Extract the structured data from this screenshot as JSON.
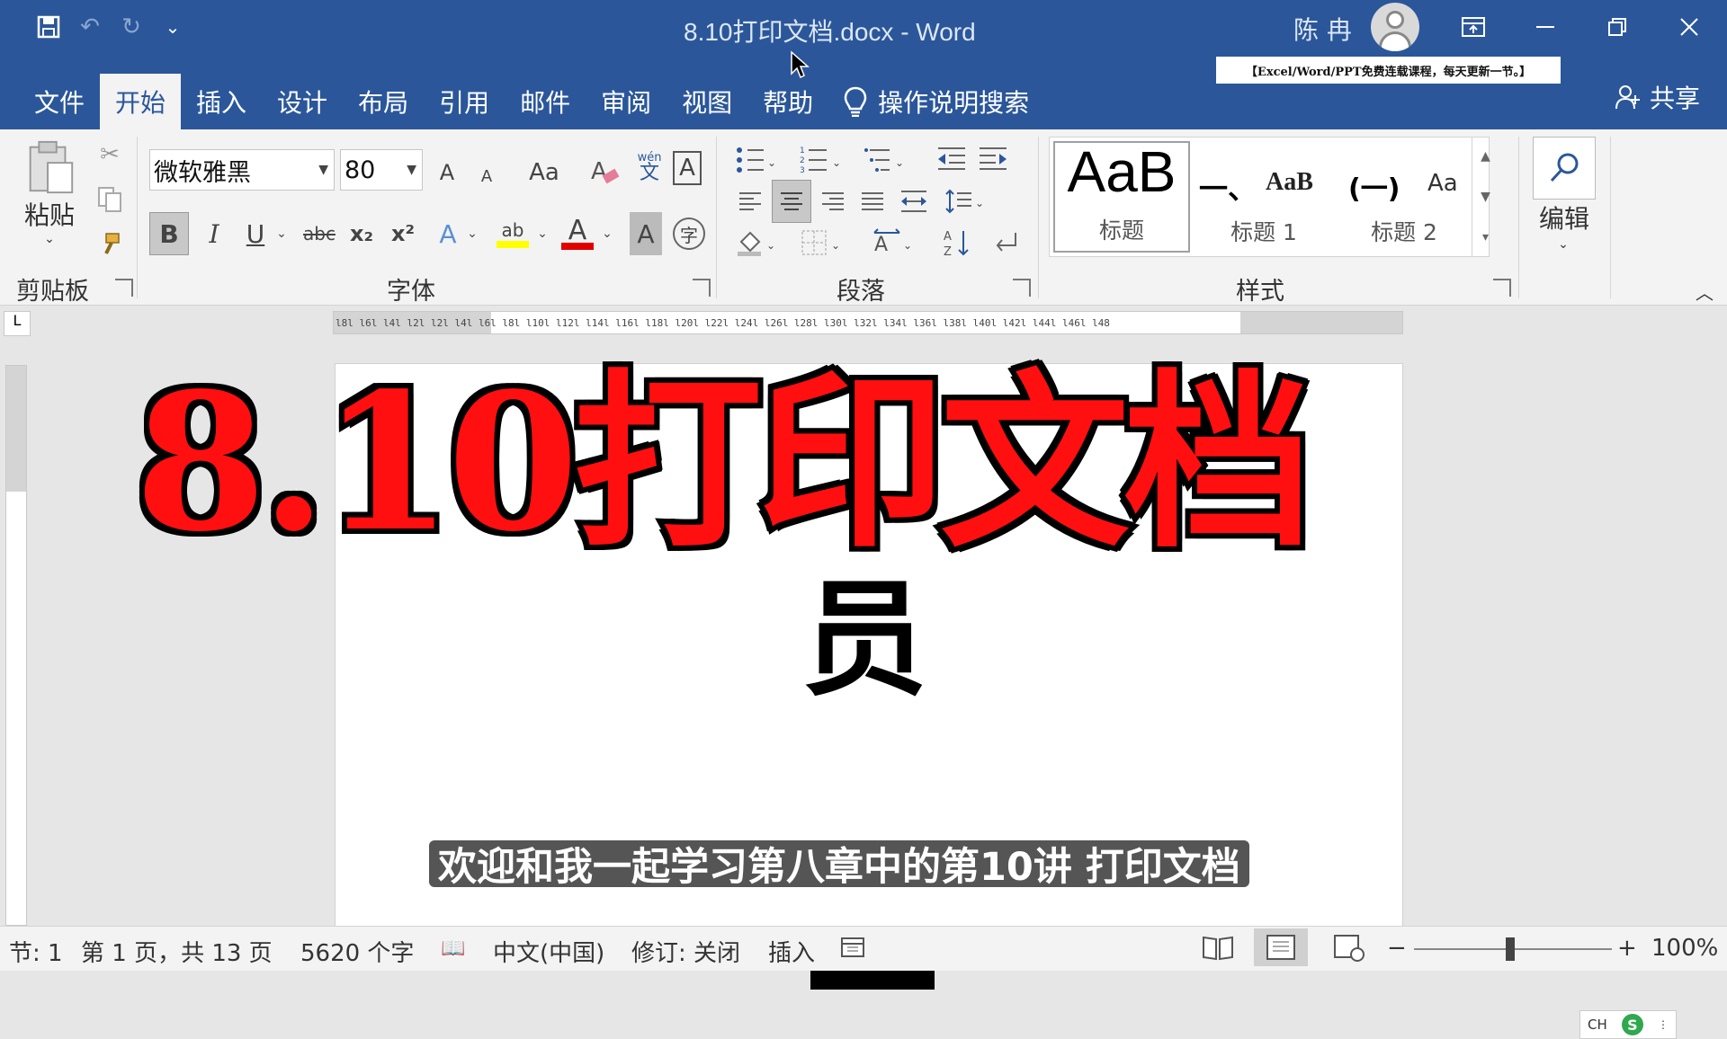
{
  "window": {
    "title": "8.10打印文档.docx  -  Word",
    "user": "陈 冉",
    "banner": "【Excel/Word/PPT免费连载课程，每天更新一节。】",
    "share": "共享"
  },
  "qat": {
    "save": "💾",
    "undo": "↶",
    "redo": "↻",
    "more": "⌄"
  },
  "tabs": [
    "文件",
    "开始",
    "插入",
    "设计",
    "布局",
    "引用",
    "邮件",
    "审阅",
    "视图",
    "帮助"
  ],
  "tab_search": "操作说明搜索",
  "ribbon": {
    "clipboard": {
      "paste": "粘贴",
      "label": "剪贴板"
    },
    "font": {
      "name": "微软雅黑",
      "size": "80",
      "label": "字体",
      "grow": "A",
      "shrink": "A",
      "case": "Aa",
      "bold": "B",
      "italic": "I",
      "underline": "U",
      "strike": "abc",
      "sub": "x₂",
      "sup": "x²",
      "effects": "A",
      "highlight": "ab",
      "color": "A",
      "shade": "A",
      "phonetic_top": "wén",
      "phonetic_bottom": "文",
      "border": "A",
      "enclose": "字"
    },
    "paragraph": {
      "label": "段落"
    },
    "styles": {
      "label": "样式",
      "items": [
        {
          "preview": "AaB",
          "name": "标题"
        },
        {
          "preview": "一、",
          "name": "标题 1"
        },
        {
          "preview": "AaB",
          "name": ""
        },
        {
          "preview": "(一)",
          "name": "标题 2"
        },
        {
          "preview": "Aa",
          "name": ""
        }
      ]
    },
    "editing": {
      "label": "编辑"
    }
  },
  "ruler": "l8l  l6l  l4l  l2l     l2l  l4l  l6l  l8l  l10l  l12l  l14l  l16l  l18l  l20l  l22l  l24l  l26l  l28l  l30l  l32l  l34l  l36l  l38l  l40l  l42l  l44l  l46l  l48",
  "document": {
    "overlay_title": "8.10打印文档",
    "char": "员",
    "subtitle": "欢迎和我一起学习第八章中的第10讲 打印文档"
  },
  "ime": {
    "lang": "CH",
    "logo": "S"
  },
  "status": {
    "section": "节: 1",
    "page": "第 1 页，共 13 页",
    "words": "5620 个字",
    "language": "中文(中国)",
    "track": "修订: 关闭",
    "insert": "插入",
    "zoom": "100%"
  },
  "colors": {
    "titlebar": "#2b579a",
    "title_red": "#ff0f0f",
    "ribbon": "#f3f3f3"
  }
}
